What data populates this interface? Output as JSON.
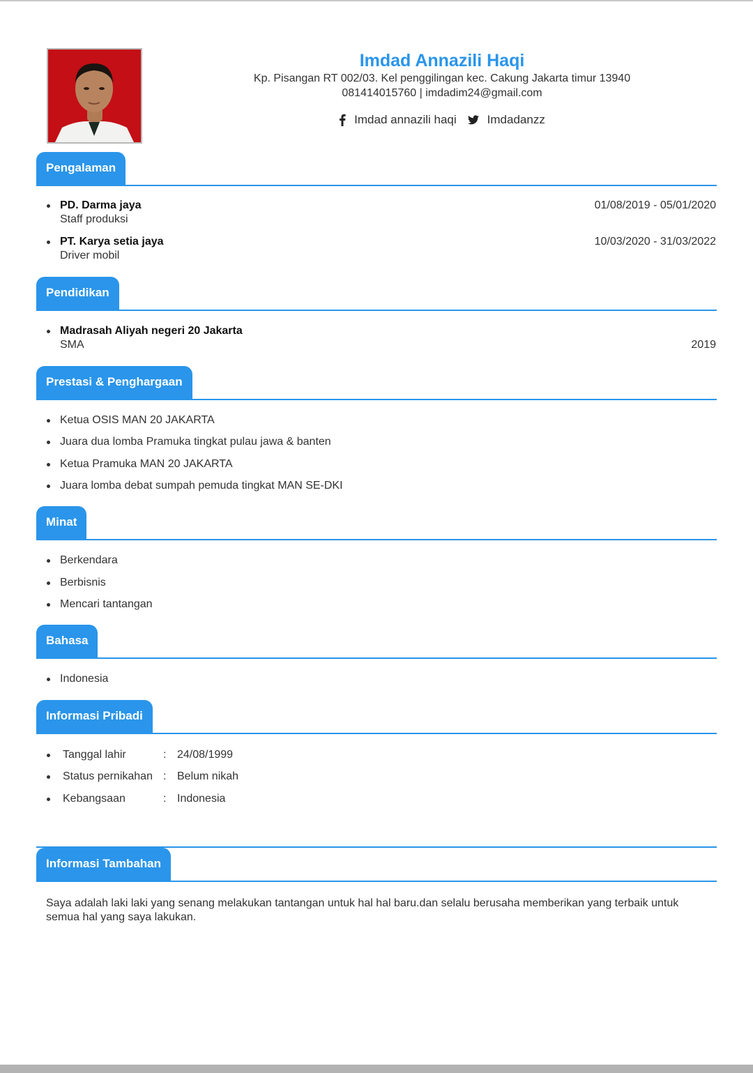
{
  "profile": {
    "name": "Imdad Annazili Haqi",
    "address": "Kp. Pisangan RT 002/03. Kel penggilingan kec. Cakung Jakarta timur 13940",
    "contact": "081414015760 |  imdadim24@gmail.com",
    "facebook": "Imdad annazili haqi",
    "twitter": "Imdadanzz",
    "photo_icon": "portrait-photo"
  },
  "colors": {
    "accent": "#2a95ea",
    "text": "#333333",
    "photo_bg": "#c30f15"
  },
  "sections": {
    "experience": {
      "title": "Pengalaman",
      "items": [
        {
          "company": "PD. Darma jaya",
          "role": "Staff produksi",
          "period": "01/08/2019 - 05/01/2020"
        },
        {
          "company": "PT. Karya setia jaya",
          "role": "Driver mobil",
          "period": "10/03/2020 - 31/03/2022"
        }
      ]
    },
    "education": {
      "title": "Pendidikan",
      "items": [
        {
          "school": "Madrasah Aliyah negeri 20 Jakarta",
          "level": "SMA",
          "year": "2019"
        }
      ]
    },
    "achievements": {
      "title": "Prestasi & Penghargaan",
      "items": [
        "Ketua OSIS MAN 20 JAKARTA",
        "Juara dua lomba Pramuka tingkat pulau jawa & banten",
        "Ketua Pramuka MAN 20 JAKARTA",
        "Juara lomba debat sumpah pemuda tingkat MAN SE-DKI"
      ]
    },
    "interests": {
      "title": "Minat",
      "items": [
        "Berkendara",
        "Berbisnis",
        "Mencari tantangan"
      ]
    },
    "languages": {
      "title": "Bahasa",
      "items": [
        "Indonesia"
      ]
    },
    "personal": {
      "title": "Informasi Pribadi",
      "items": [
        {
          "label": "Tanggal lahir",
          "sep": ":",
          "value": "24/08/1999"
        },
        {
          "label": "Status pernikahan",
          "sep": ":",
          "value": "Belum nikah"
        },
        {
          "label": "Kebangsaan",
          "sep": ":",
          "value": "Indonesia"
        }
      ]
    },
    "additional": {
      "title": "Informasi Tambahan",
      "text": "Saya adalah laki laki yang senang melakukan tantangan untuk hal hal baru.dan selalu berusaha memberikan yang terbaik untuk semua hal yang saya lakukan."
    }
  }
}
